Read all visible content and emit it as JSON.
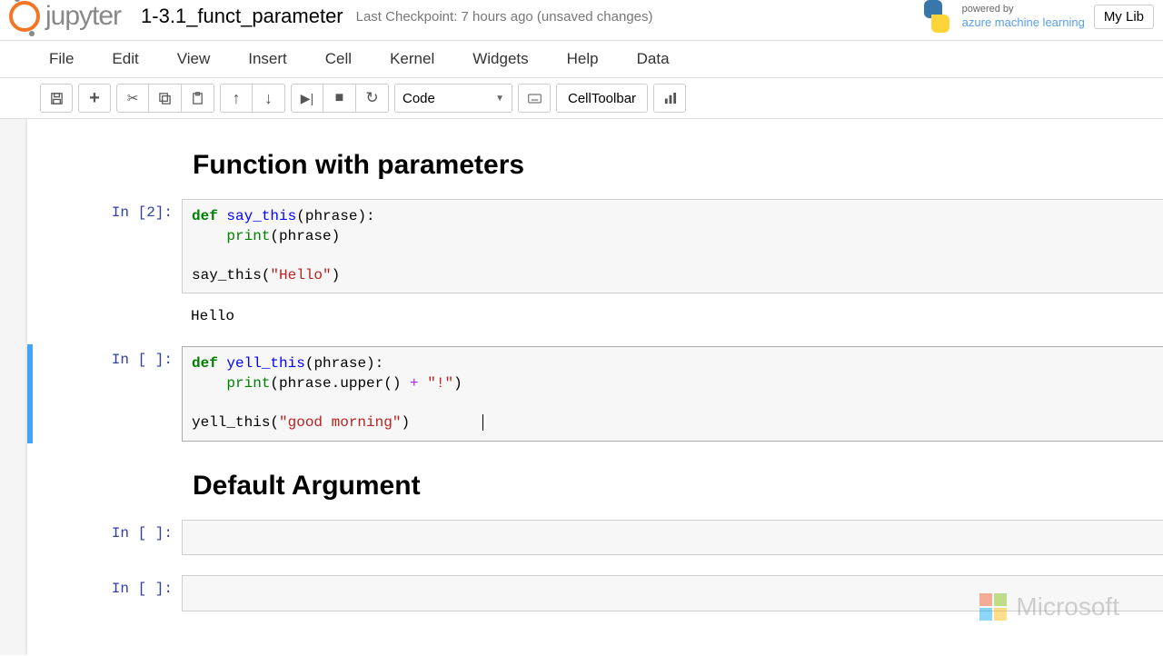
{
  "header": {
    "logo_text": "jupyter",
    "notebook_name": "1-3.1_funct_parameter",
    "checkpoint": "Last Checkpoint: 7 hours ago (unsaved changes)",
    "powered_by": "powered by",
    "aml": "azure machine learning",
    "right_button": "My Lib"
  },
  "menu": [
    "File",
    "Edit",
    "View",
    "Insert",
    "Cell",
    "Kernel",
    "Widgets",
    "Help",
    "Data"
  ],
  "toolbar": {
    "cell_type": "Code",
    "cell_toolbar": "CellToolbar"
  },
  "cells": {
    "heading1": "Function with parameters",
    "cell1": {
      "prompt": "In [2]:",
      "code": {
        "def": "def",
        "fn": "say_this",
        "args": "(phrase):",
        "print": "print",
        "pargs": "(phrase)",
        "call": "say_this(",
        "str": "\"Hello\"",
        "close": ")"
      },
      "output": "Hello"
    },
    "cell2": {
      "prompt": "In [ ]:",
      "code": {
        "def": "def",
        "fn": "yell_this",
        "args": "(phrase):",
        "print": "print",
        "pargs_pre": "(phrase.upper() ",
        "plus": "+",
        "ex": " \"!\"",
        "pargs_post": ")",
        "call": "yell_this(",
        "str": "\"good morning\"",
        "close": ")"
      }
    },
    "heading2": "Default Argument",
    "cell3_prompt": "In [ ]:",
    "cell4_prompt": "In [ ]:"
  },
  "footer": {
    "ms": "Microsoft"
  }
}
